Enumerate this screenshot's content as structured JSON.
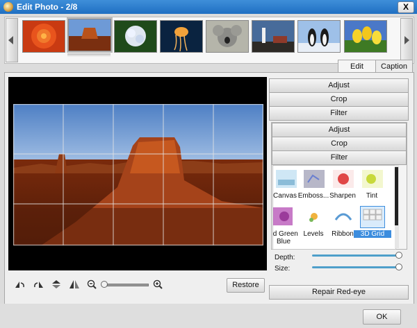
{
  "window": {
    "title": "Edit Photo - 2/8",
    "close_label": "X"
  },
  "filmstrip": {
    "thumbnails": [
      {
        "name": "Chrysanthemum",
        "selected": false
      },
      {
        "name": "Desert",
        "selected": true
      },
      {
        "name": "Hydrangeas",
        "selected": false
      },
      {
        "name": "Jellyfish",
        "selected": false
      },
      {
        "name": "Koala",
        "selected": false
      },
      {
        "name": "Lighthouse",
        "selected": false
      },
      {
        "name": "Penguins",
        "selected": false
      },
      {
        "name": "Tulips",
        "selected": false
      }
    ]
  },
  "tabs": [
    {
      "label": "Edit",
      "active": true
    },
    {
      "label": "Caption",
      "active": false
    }
  ],
  "sections": {
    "adjust": "Adjust",
    "crop": "Crop",
    "filter": "Filter"
  },
  "subsections": {
    "adjust": "Adjust",
    "crop": "Crop",
    "filter": "Filter"
  },
  "filters": [
    {
      "label": "Canvas"
    },
    {
      "label": "Emboss..."
    },
    {
      "label": "Sharpen"
    },
    {
      "label": "Tint"
    },
    {
      "label": "ed Green Blue"
    },
    {
      "label": "Levels"
    },
    {
      "label": "Ribbon"
    },
    {
      "label": "3D Grid",
      "selected": true
    }
  ],
  "params": {
    "depth_label": "Depth:",
    "depth_value": 1.0,
    "size_label": "Size:",
    "size_value": 1.0
  },
  "zoom": {
    "value": 0.0
  },
  "buttons": {
    "restore": "Restore",
    "red_eye": "Repair Red-eye",
    "ok": "OK"
  },
  "colors": {
    "titlebar": "#2a7bd1",
    "slider": "#4e9fca",
    "selection": "#3c8dde"
  }
}
